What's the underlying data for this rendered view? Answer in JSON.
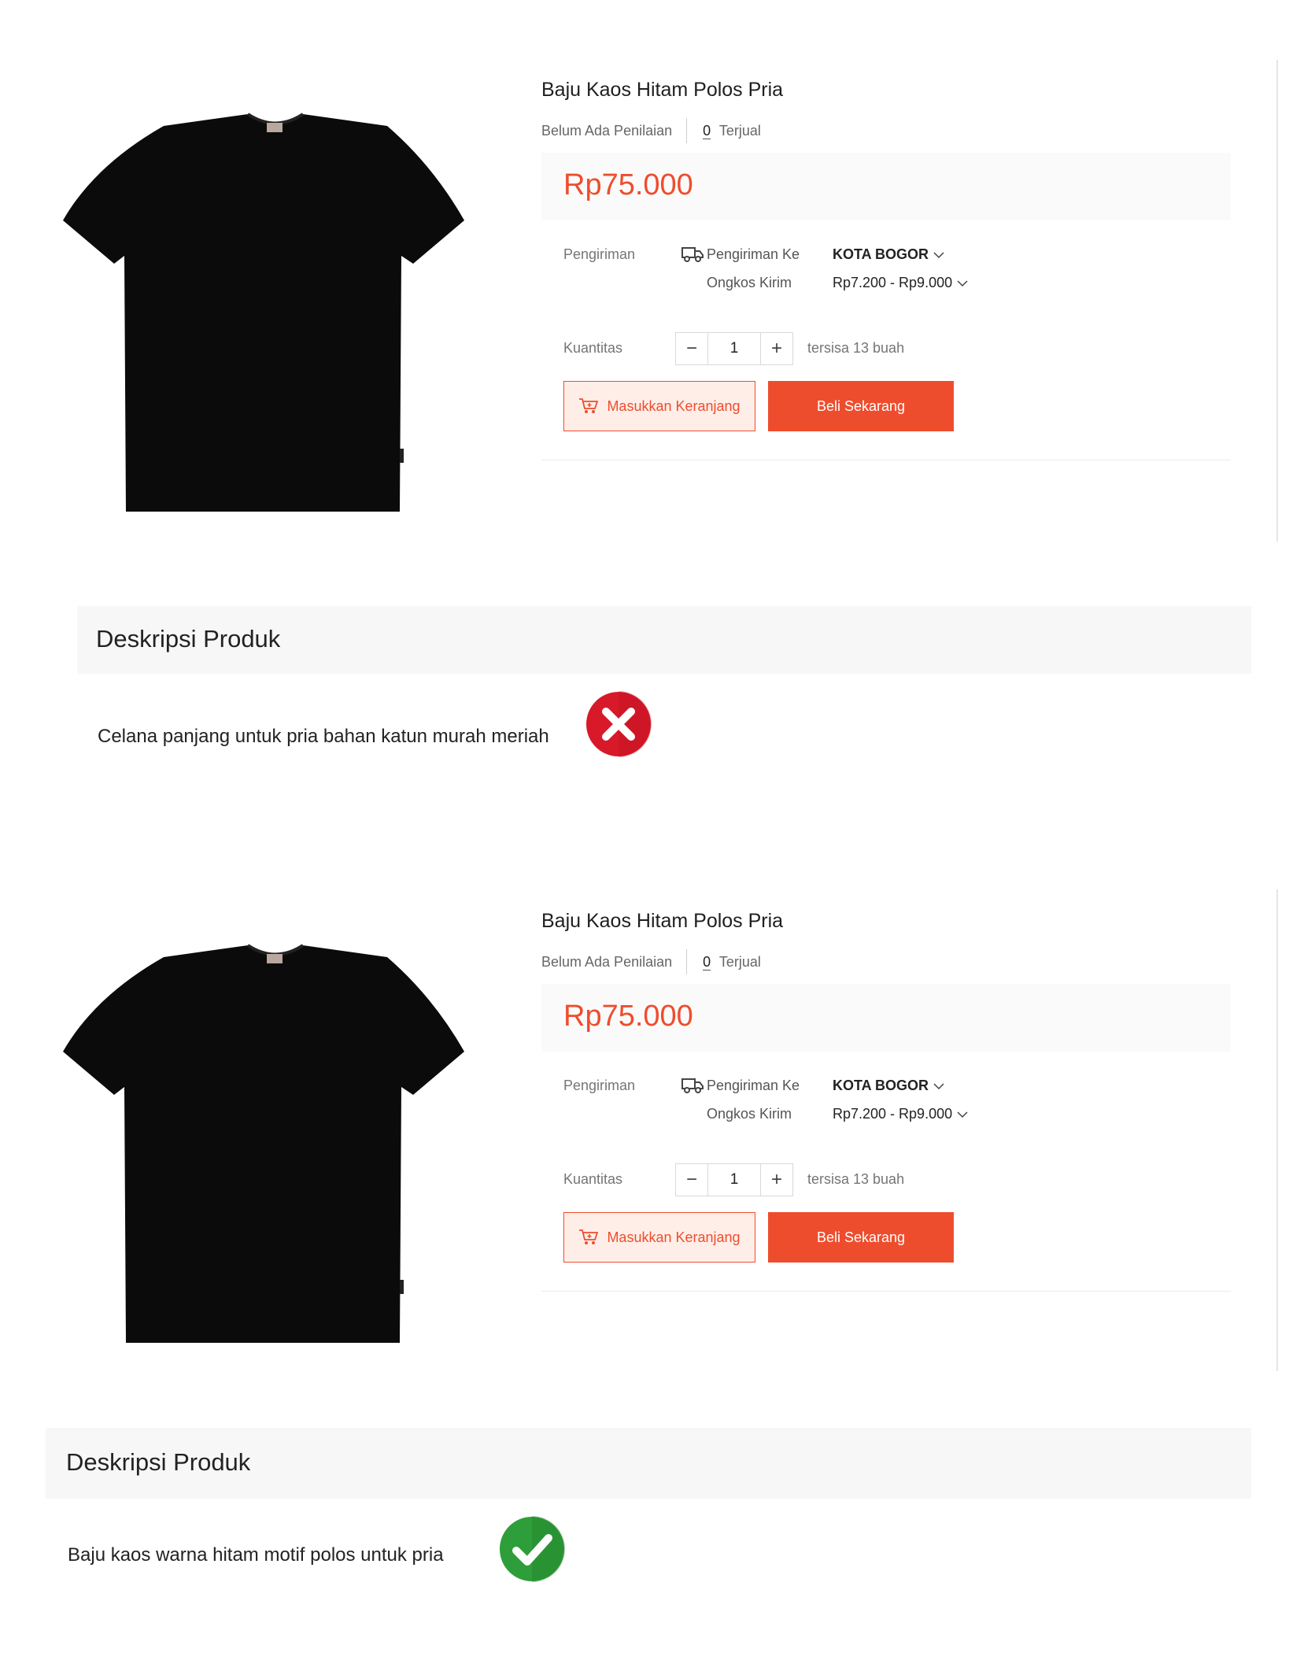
{
  "panels": [
    {
      "title": "Baju Kaos Hitam Polos Pria",
      "rating_text": "Belum Ada Penilaian",
      "sold_count": "0",
      "sold_label": "Terjual",
      "price": "Rp75.000",
      "shipping_label": "Pengiriman",
      "ship_to_label": "Pengiriman Ke",
      "ship_to_value": "KOTA BOGOR",
      "ongkos_label": "Ongkos Kirim",
      "ongkos_value": "Rp7.200 - Rp9.000",
      "quantity_label": "Kuantitas",
      "quantity_value": "1",
      "minus": "−",
      "plus": "+",
      "stock_text": "tersisa 13 buah",
      "add_to_cart": "Masukkan Keranjang",
      "buy_now": "Beli Sekarang",
      "desc_title": "Deskripsi Produk",
      "desc_text": "Celana panjang untuk pria bahan katun murah meriah",
      "verdict_icon": "cross-icon"
    },
    {
      "title": "Baju Kaos Hitam Polos Pria",
      "rating_text": "Belum Ada Penilaian",
      "sold_count": "0",
      "sold_label": "Terjual",
      "price": "Rp75.000",
      "shipping_label": "Pengiriman",
      "ship_to_label": "Pengiriman Ke",
      "ship_to_value": "KOTA BOGOR",
      "ongkos_label": "Ongkos Kirim",
      "ongkos_value": "Rp7.200 - Rp9.000",
      "quantity_label": "Kuantitas",
      "quantity_value": "1",
      "minus": "−",
      "plus": "+",
      "stock_text": "tersisa 13 buah",
      "add_to_cart": "Masukkan Keranjang",
      "buy_now": "Beli Sekarang",
      "desc_title": "Deskripsi Produk",
      "desc_text": "Baju kaos warna hitam motif polos untuk pria",
      "verdict_icon": "check-icon"
    }
  ],
  "colors": {
    "accent": "#ee4d2d",
    "accent_light": "#ffeee8",
    "cross_red": "#d7192a",
    "check_green": "#2e9e3a"
  }
}
